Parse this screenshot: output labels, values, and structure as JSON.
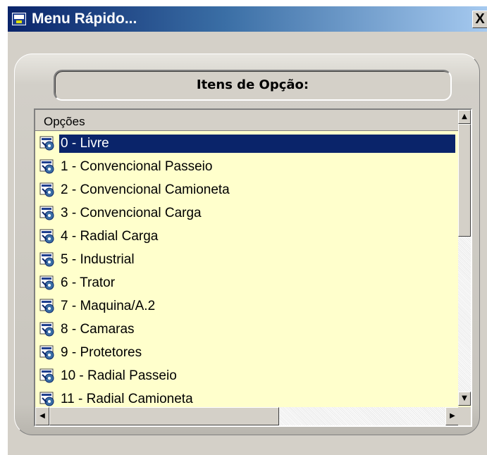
{
  "window": {
    "title": "Menu Rápido...",
    "close_label": "X",
    "app_icon": "app-window-icon"
  },
  "panel": {
    "header": "Itens de Opção:"
  },
  "list": {
    "column_header": "Opções",
    "selected_index": 0,
    "item_icon": "tire-list-icon",
    "items": [
      {
        "label": "0 - Livre"
      },
      {
        "label": "1 - Convencional Passeio"
      },
      {
        "label": "2 - Convencional Camioneta"
      },
      {
        "label": "3 - Convencional Carga"
      },
      {
        "label": "4 - Radial Carga"
      },
      {
        "label": "5 - Industrial"
      },
      {
        "label": "6 - Trator"
      },
      {
        "label": "7 - Maquina/A.2"
      },
      {
        "label": "8 - Camaras"
      },
      {
        "label": "9 - Protetores"
      },
      {
        "label": "10 - Radial Passeio"
      },
      {
        "label": "11 - Radial Camioneta"
      }
    ]
  },
  "scrollbars": {
    "up_arrow": "▲",
    "down_arrow": "▼",
    "left_arrow": "◀",
    "right_arrow": "▶"
  },
  "colors": {
    "selection": "#0a246a",
    "list_background": "#ffffcc",
    "titlebar_start": "#0a246a",
    "titlebar_end": "#a6caf0"
  }
}
